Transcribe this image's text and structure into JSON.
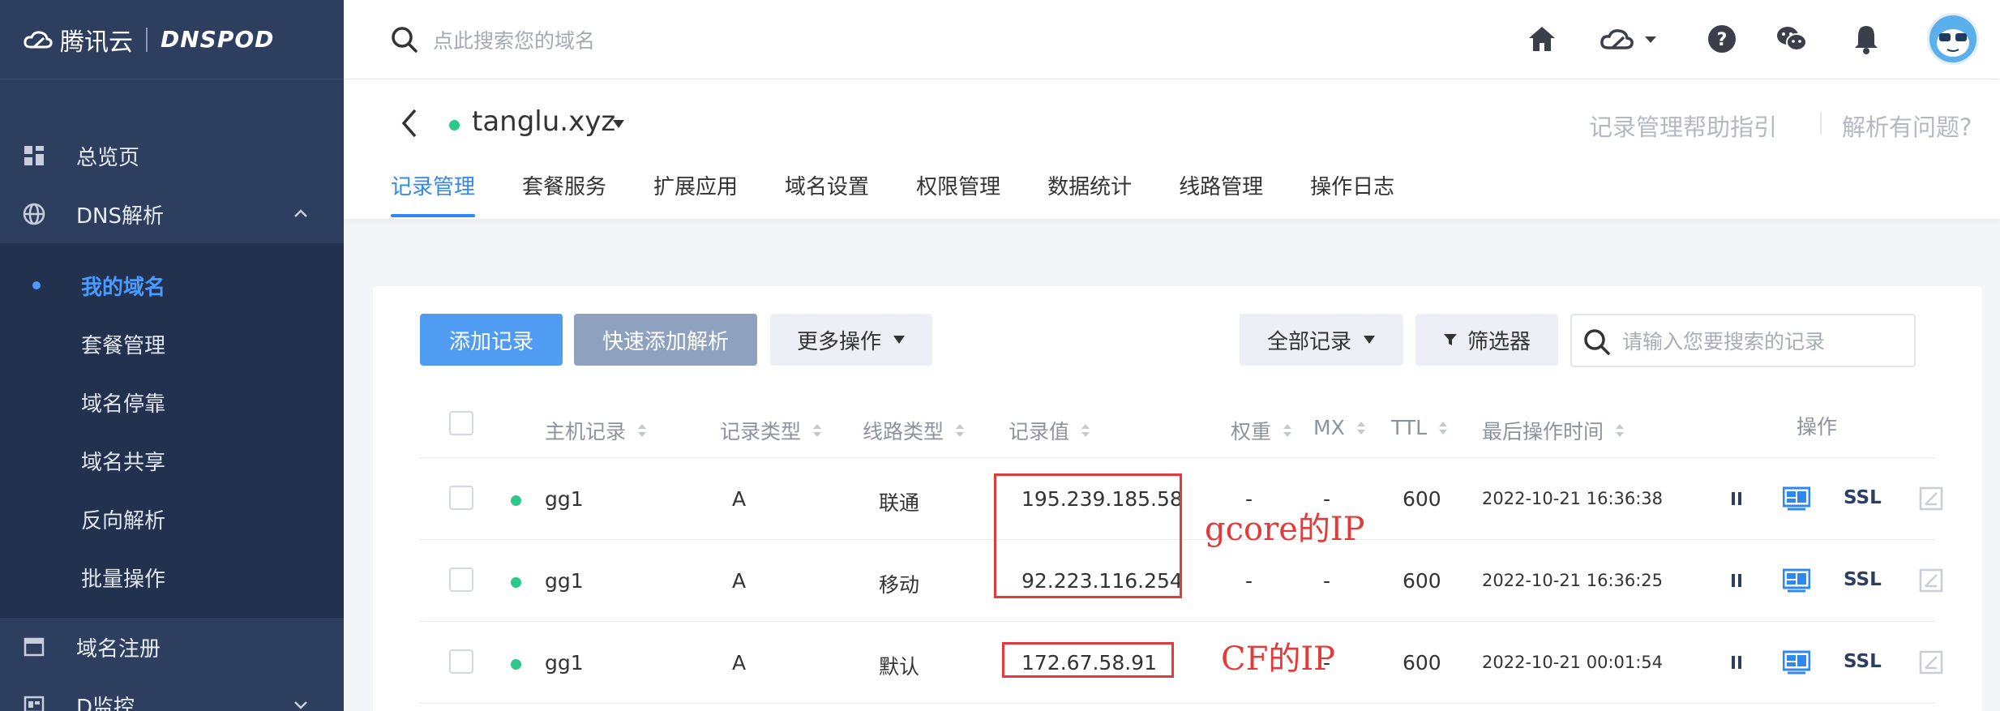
{
  "brand": {
    "cn": "腾讯云",
    "en": "DNSPOD"
  },
  "sidebar": {
    "overview": "总览页",
    "dns": "DNS解析",
    "sub_items": [
      "我的域名",
      "套餐管理",
      "域名停靠",
      "域名共享",
      "反向解析",
      "批量操作"
    ],
    "domain_register": "域名注册",
    "monitor": "D监控"
  },
  "topbar": {
    "search_placeholder": "点此搜索您的域名"
  },
  "domain": {
    "name": "tanglu.xyz",
    "help_guide": "记录管理帮助指引",
    "help_issue": "解析有问题?"
  },
  "tabs": [
    "记录管理",
    "套餐服务",
    "扩展应用",
    "域名设置",
    "权限管理",
    "数据统计",
    "线路管理",
    "操作日志"
  ],
  "toolbar": {
    "add_record": "添加记录",
    "quick_add": "快速添加解析",
    "more_actions": "更多操作",
    "all_records": "全部记录",
    "filter": "筛选器",
    "search_placeholder": "请输入您要搜索的记录"
  },
  "table": {
    "headers": {
      "host": "主机记录",
      "type": "记录类型",
      "line": "线路类型",
      "value": "记录值",
      "weight": "权重",
      "mx": "MX",
      "ttl": "TTL",
      "time": "最后操作时间",
      "ops": "操作"
    },
    "rows": [
      {
        "host": "gg1",
        "type": "A",
        "line": "联通",
        "value": "195.239.185.58",
        "weight": "-",
        "mx": "-",
        "ttl": "600",
        "time": "2022-10-21 16:36:38",
        "ssl": "SSL"
      },
      {
        "host": "gg1",
        "type": "A",
        "line": "移动",
        "value": "92.223.116.254",
        "weight": "-",
        "mx": "-",
        "ttl": "600",
        "time": "2022-10-21 16:36:25",
        "ssl": "SSL"
      },
      {
        "host": "gg1",
        "type": "A",
        "line": "默认",
        "value": "172.67.58.91",
        "weight": "",
        "mx": "-",
        "ttl": "600",
        "time": "2022-10-21 00:01:54",
        "ssl": "SSL"
      }
    ]
  },
  "annotations": {
    "gcore": "gcore的IP",
    "cf": "CF的IP"
  },
  "colors": {
    "sidebar": "#2d3e5e",
    "accent": "#2f88f0",
    "status": "#2dc78a",
    "annotation": "#e23b3b"
  }
}
